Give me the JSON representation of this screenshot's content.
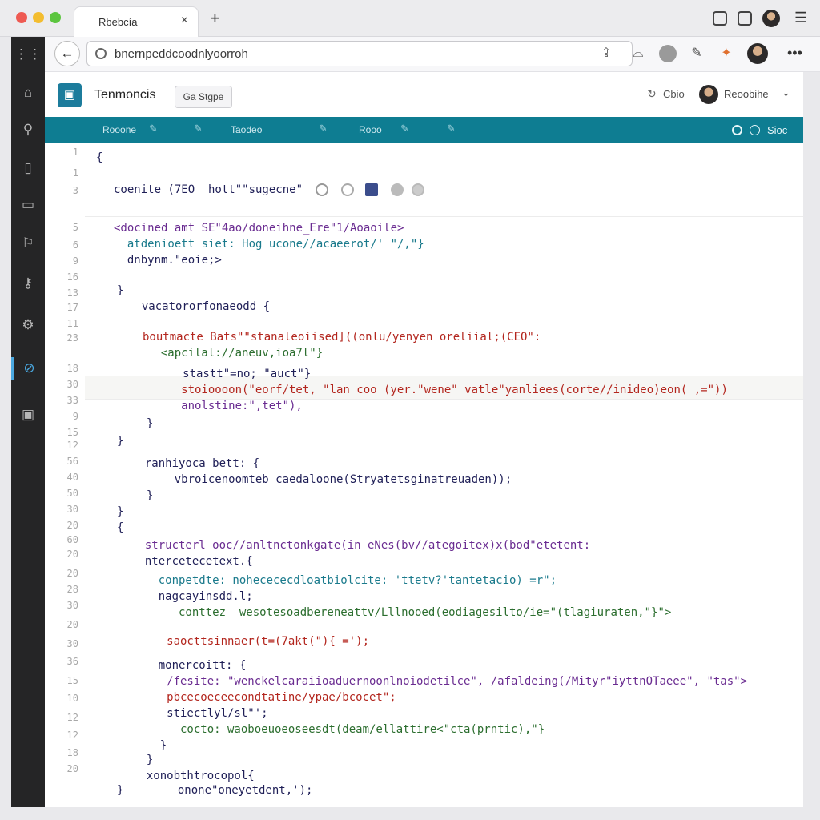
{
  "browser": {
    "tab_title": "Rbebcía",
    "tab_close": "×",
    "new_tab": "+",
    "menu": "☰",
    "url": "bnernpeddcoodnlyoorroh",
    "back": "←",
    "more": "•••"
  },
  "app": {
    "logo": "▣",
    "name": "Tenmoncis",
    "button_label": "Ga Stgpe",
    "header_link": "Cbio",
    "user_name": "Reoobihe",
    "chevron": "⌄"
  },
  "toolbar": {
    "items": [
      "Rooone",
      "Taodeo",
      "Rooo"
    ],
    "right_label": "Sioc"
  },
  "line_numbers": [
    "1",
    "1",
    "3",
    "5",
    "6",
    "9",
    "16",
    "13",
    "17",
    "11",
    "23",
    "18",
    "30",
    "33",
    "9",
    "15",
    "12",
    "56",
    "40",
    "50",
    "30",
    "20",
    "60",
    "20",
    "20",
    "28",
    "30",
    "20",
    "30",
    "36",
    "15",
    "10",
    "12",
    "12",
    "18",
    "20"
  ],
  "code_lines": [
    "{",
    "coenite (7EO  hott\"\"sugecne\"",
    "<docined amt SE\"4ao/doneihne_Ere\"1/Aoaoile>",
    "  atdenioett siet: Hog ucone//acaeerot/' \"/,\"}",
    "  dnbynm.\"eoie;>",
    "}",
    "  vacatororfonaeodd {",
    "boutmacte Bats\"\"stanaleoiised]((onlu/yenyen oreliial;(CEO\":",
    "  <apcilal://aneuv,ioa7l\"}",
    "     stastt\"=no; \"auct\"}",
    "     stoioooon(\"eorf/tet, \"lan coo (yer.\"wene\" vatle\"yanliees(corte//inideo)eon( ,=\"))",
    "     anolstine:\",tet\"),",
    "  }",
    "}",
    "  ranhiyoca bett: {",
    "    vbroicenoomteb caedaloone(Stryatetsginatreuaden));",
    "  }",
    "}",
    "{",
    "  structerl ooc//anltnctonkgate(in eNes(bv//ategoitex)x(bod\"etetent:",
    "  ntercetecetext.{",
    "    conpetdte: nohecececdloatbiolcite: 'ttetv?'tantetacio) =r\";",
    "    nagcayinsdd.l;",
    "       conttez  wesotesoadbereneattv/Lllnooed(eodiagesilto/ie=\"(tlagiuraten,\"}\">",
    "     saocttsinnaer(t=(7akt(\"){ =');",
    "    monercoitt: {",
    "     /fesite: \"wenckelcaraiioaduernoonlnoiodetilce\", /afaldeing(/Mityr\"iyttnOTaeee\", \"tas\">",
    "     pbcecoeceecondtatine/ypae/bcocet\";",
    "     stiectlyl/sl\"';",
    "       cocto: waoboeuoeoseesdt(deam/ellattire<\"cta(prntic),\"}",
    "    }",
    "  }",
    "  xonobthtrocopol{",
    "}        onone\"oneyetdent,');",
    "}"
  ]
}
